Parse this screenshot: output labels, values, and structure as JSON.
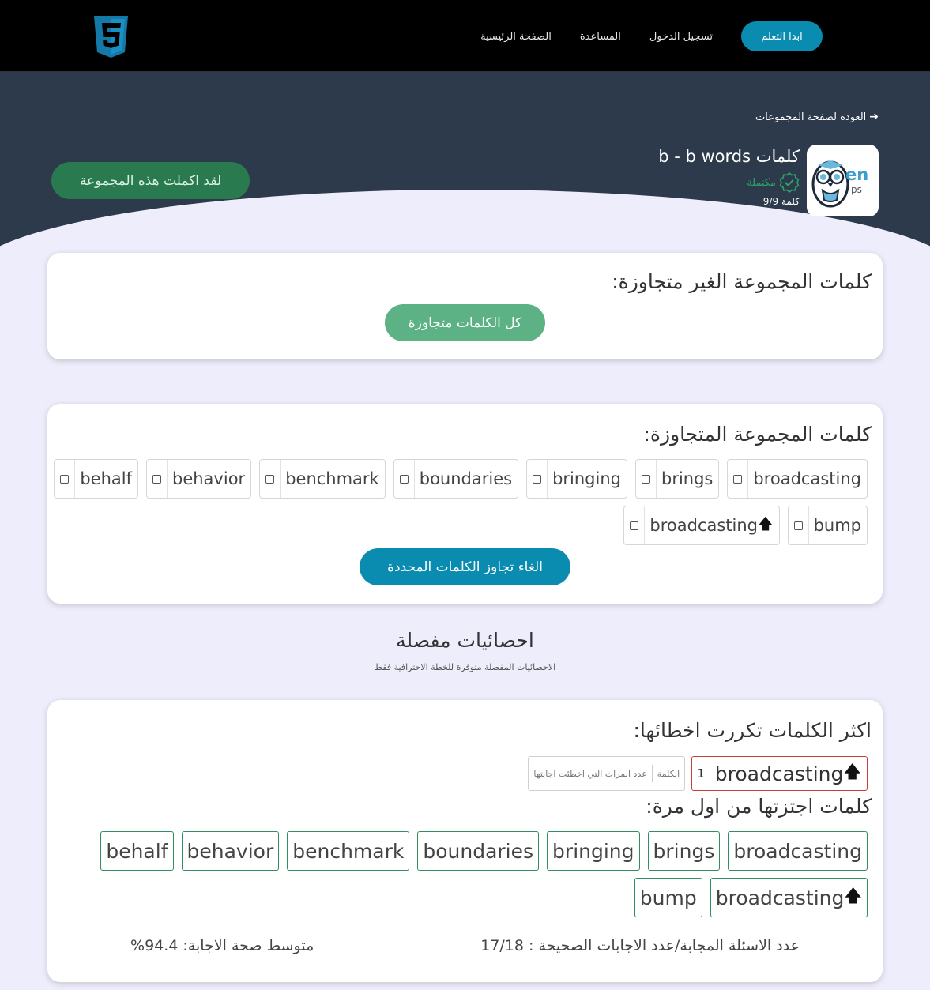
{
  "nav": {
    "logo_icon": "html5-icon",
    "cta_label": "ابدا التعلم",
    "links": [
      "تسجيل الدخول",
      "المساعدة",
      "الصفحة الرئيسية"
    ]
  },
  "hero": {
    "back_label": "العودة لصفحة المجموعات",
    "logo_text_en": "en",
    "logo_text_ps": "ps",
    "set_title": "كلمات b - b words",
    "status_label": "مكتملة",
    "word_count": "9/9 كلمة",
    "complete_button": "لقد اكملت هذه المجموعة"
  },
  "unskipped": {
    "title": "كلمات المجموعة الغير متجاوزة:",
    "all_skipped_button": "كل الكلمات متجاوزة"
  },
  "skipped": {
    "title": "كلمات المجموعة المتجاوزة:",
    "row1": [
      "broadcasting",
      "brings",
      "bringing",
      "boundaries",
      "benchmark",
      "behavior",
      "behalf"
    ],
    "row2": [
      "bump",
      "broadcasting"
    ],
    "unskip_button": "الغاء تجاوز الكلمات المحددة"
  },
  "stats": {
    "title": "احصائيات مفصلة",
    "subtitle": "الاحصائيات المفصلة متوفرة للخطة الاحترافية فقط",
    "most_mistakes_title": "اكثر الكلمات تكررت اخطائها:",
    "mistake_word": "broadcasting",
    "mistake_count": "1",
    "legend_word": "الكلمة",
    "legend_count": "عدد المرات التي اخطئت اجابتها",
    "first_try_title": "كلمات اجتزتها من اول مرة:",
    "first_try_row1": [
      "broadcasting",
      "brings",
      "bringing",
      "boundaries",
      "benchmark",
      "behavior",
      "behalf"
    ],
    "first_try_row2": [
      "broadcasting",
      "bump"
    ],
    "answered_label": "عدد الاسئلة المجابة/عدد الاجابات الصحيحة : 17/18",
    "accuracy_label": "متوسط صحة الاجابة: 94.4%"
  },
  "colors": {
    "nav_cta": "#0a8bb0",
    "hero_bg": "#2d3a4b",
    "complete_btn": "#2a7a4f",
    "all_skipped_btn": "#5cb284",
    "unskip_btn": "#0a8bb0",
    "status_green": "#29a567",
    "mistake_border": "#c93c3c",
    "first_try_border": "#2f8f5f"
  }
}
